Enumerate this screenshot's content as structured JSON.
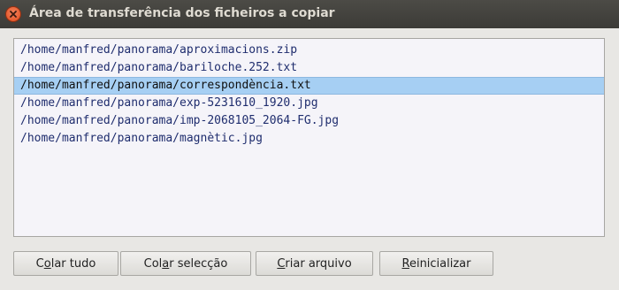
{
  "window": {
    "title": "Área de transferência dos ficheiros a copiar",
    "close_icon": "close-icon"
  },
  "files": [
    "/home/manfred/panorama/aproximacions.zip",
    "/home/manfred/panorama/bariloche.252.txt",
    "/home/manfred/panorama/correspondència.txt",
    "/home/manfred/panorama/exp-5231610_1920.jpg",
    "/home/manfred/panorama/imp-2068105_2064-FG.jpg",
    "/home/manfred/panorama/magnètic.jpg"
  ],
  "selected_index": 2,
  "buttons": {
    "paste_all": {
      "pre": "C",
      "acc": "o",
      "post": "lar tudo"
    },
    "paste_selection": {
      "pre": "Col",
      "acc": "a",
      "post": "r selecção"
    },
    "create_archive": {
      "pre": "",
      "acc": "C",
      "post": "riar arquivo"
    },
    "reset": {
      "pre": "",
      "acc": "R",
      "post": "einicializar"
    }
  }
}
